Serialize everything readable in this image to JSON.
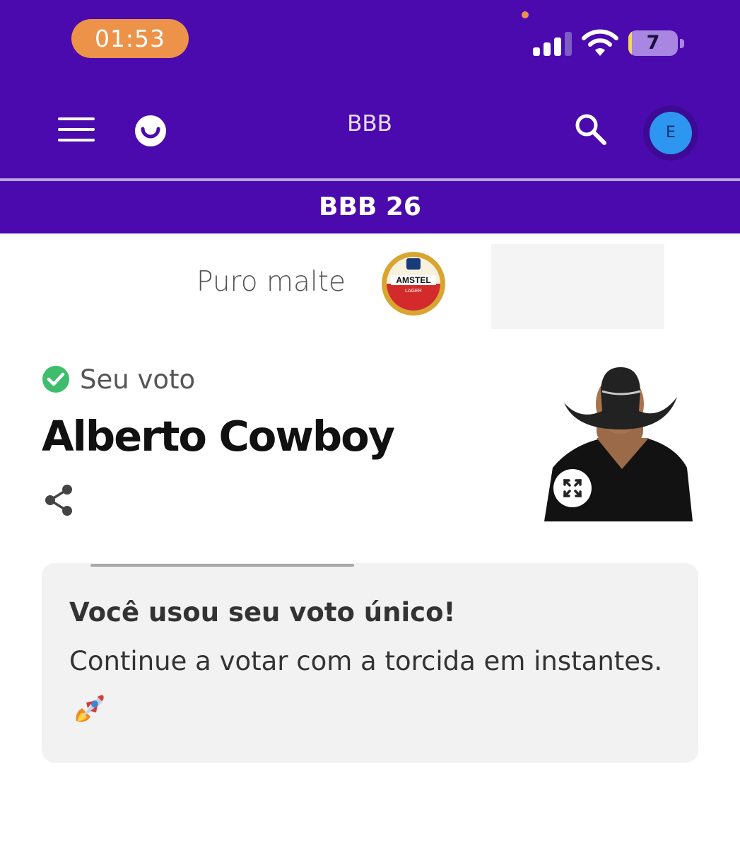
{
  "status_bar": {
    "time": "01:53",
    "battery_level": "7",
    "battery_fraction": 0.07,
    "signal_bars_active": 3,
    "signal_bars_total": 4
  },
  "header": {
    "title": "BBB",
    "menu_icon": "hamburger-menu-icon",
    "logo_icon": "smile-logo-icon",
    "search_icon": "search-icon",
    "avatar_initial": "E"
  },
  "subheader": {
    "title": "BBB 26"
  },
  "sponsor": {
    "text": "Puro malte",
    "logo_text": "AMSTEL",
    "logo_subtext": "LAGER"
  },
  "vote": {
    "label": "Seu voto",
    "candidate_name": "Alberto Cowboy",
    "share_icon": "share-icon",
    "expand_icon": "expand-icon"
  },
  "notice": {
    "title": "Você usou seu voto único!",
    "message": "Continue a votar com a torcida em instantes.",
    "emoji_icon": "rocket-icon"
  },
  "colors": {
    "brand_purple": "#4b0aad",
    "time_pill": "#ec9349",
    "check_green": "#3ebd6c",
    "avatar_blue": "#2d96f0",
    "card_bg": "#f2f2f2"
  }
}
